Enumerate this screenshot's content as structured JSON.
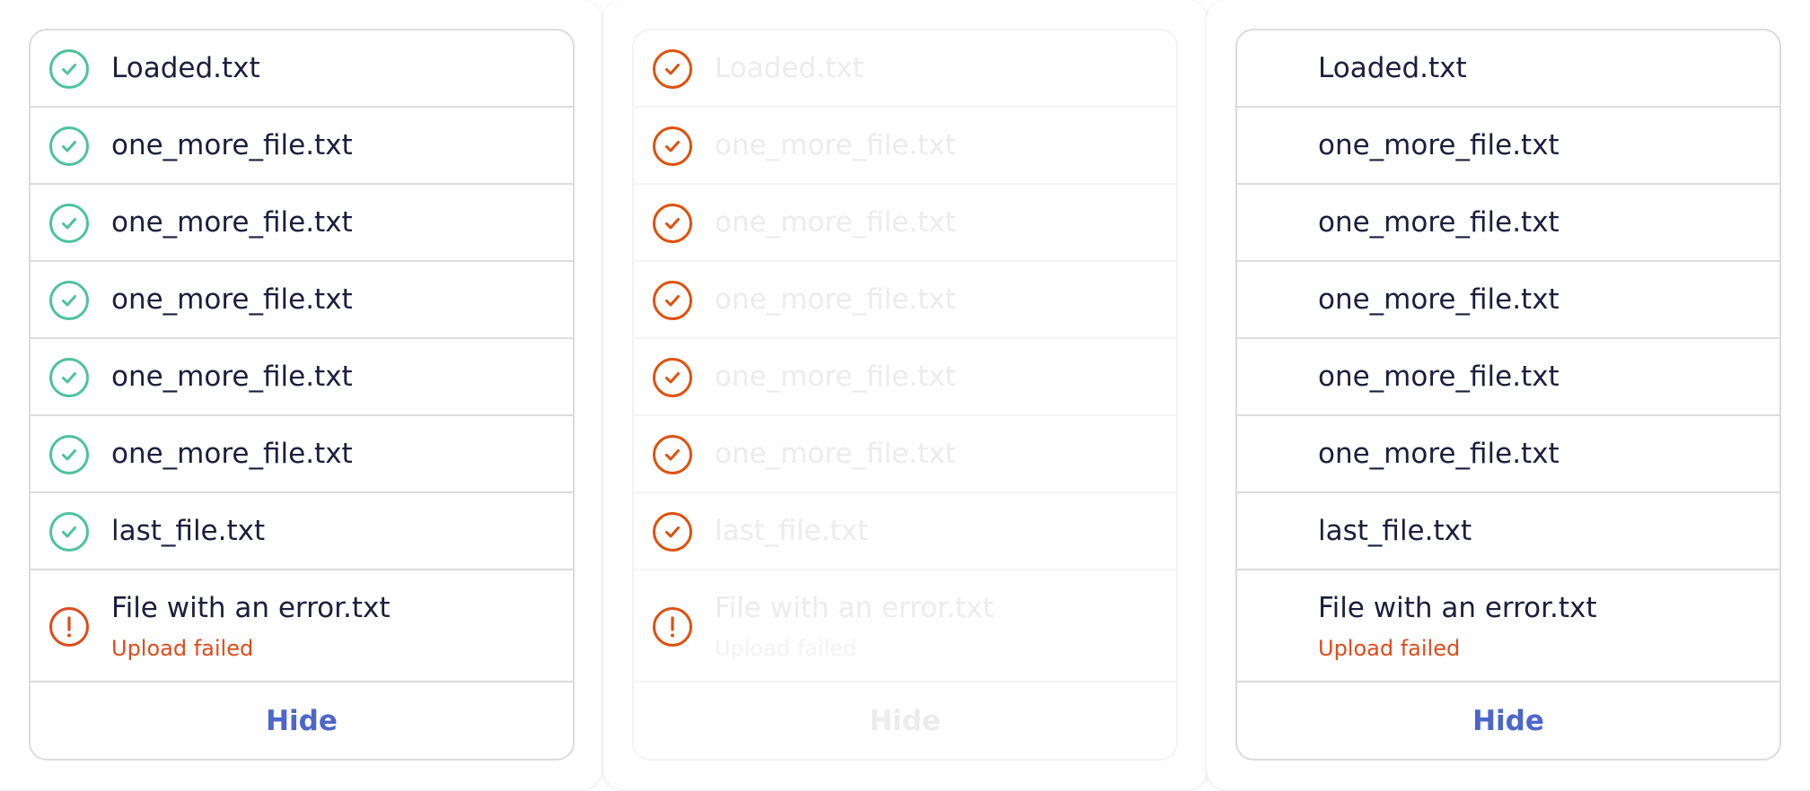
{
  "colors": {
    "success": "#4cc39a",
    "error": "#e04a1b",
    "error_icon_dark": "#e0500b",
    "text": "#1b1e3d",
    "link": "#4c66cc"
  },
  "panels": [
    {
      "variant": "normal",
      "files": [
        {
          "name": "Loaded.txt",
          "icon": "check-circle-icon"
        },
        {
          "name": "one_more_file.txt",
          "icon": "check-circle-icon"
        },
        {
          "name": "one_more_file.txt",
          "icon": "check-circle-icon"
        },
        {
          "name": "one_more_file.txt",
          "icon": "check-circle-icon"
        },
        {
          "name": "one_more_file.txt",
          "icon": "check-circle-icon"
        },
        {
          "name": "one_more_file.txt",
          "icon": "check-circle-icon"
        },
        {
          "name": "last_file.txt",
          "icon": "check-circle-icon"
        }
      ],
      "error_file": {
        "name": "File with an error.txt",
        "message": "Upload failed",
        "icon": "error-circle-icon"
      },
      "hide_label": "Hide"
    },
    {
      "variant": "faded",
      "files": [
        {
          "name": "Loaded.txt",
          "icon": "check-circle-icon"
        },
        {
          "name": "one_more_file.txt",
          "icon": "check-circle-icon"
        },
        {
          "name": "one_more_file.txt",
          "icon": "check-circle-icon"
        },
        {
          "name": "one_more_file.txt",
          "icon": "check-circle-icon"
        },
        {
          "name": "one_more_file.txt",
          "icon": "check-circle-icon"
        },
        {
          "name": "one_more_file.txt",
          "icon": "check-circle-icon"
        },
        {
          "name": "last_file.txt",
          "icon": "check-circle-icon"
        }
      ],
      "error_file": {
        "name": "File with an error.txt",
        "message": "Upload failed",
        "icon": "error-circle-icon"
      },
      "hide_label": "Hide"
    },
    {
      "variant": "no-icons",
      "files": [
        {
          "name": "Loaded.txt"
        },
        {
          "name": "one_more_file.txt"
        },
        {
          "name": "one_more_file.txt"
        },
        {
          "name": "one_more_file.txt"
        },
        {
          "name": "one_more_file.txt"
        },
        {
          "name": "one_more_file.txt"
        },
        {
          "name": "last_file.txt"
        }
      ],
      "error_file": {
        "name": "File with an error.txt",
        "message": "Upload failed"
      },
      "hide_label": "Hide"
    }
  ]
}
